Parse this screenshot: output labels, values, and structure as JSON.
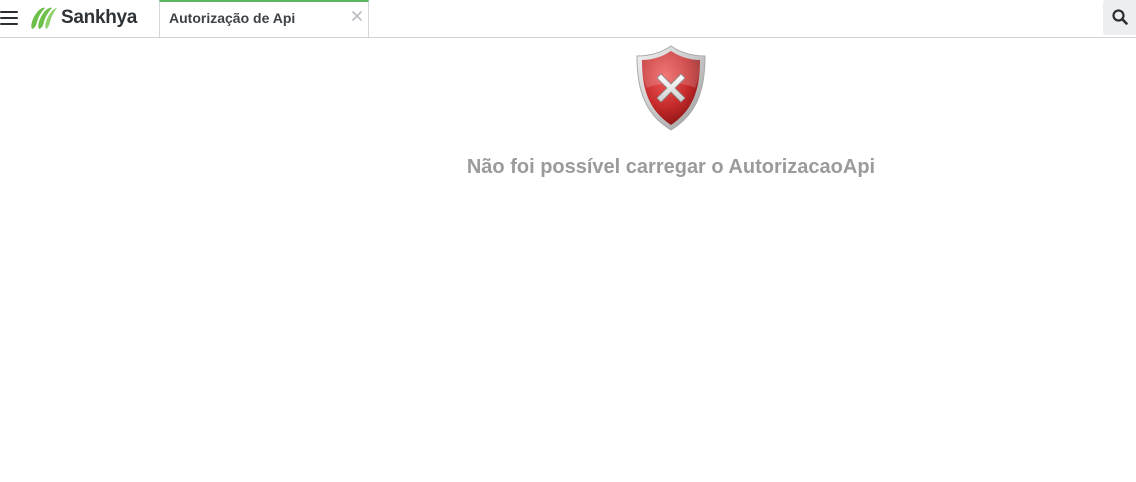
{
  "header": {
    "brand_name": "Sankhya",
    "brand_color": "#6cc04a",
    "menu_icon": "hamburger-icon",
    "search_icon": "search-icon"
  },
  "tabs": [
    {
      "label": "Autorização de Api",
      "active": true,
      "accent_color": "#5cb85c"
    }
  ],
  "main": {
    "error_icon": "error-shield-icon",
    "error_color": "#c62a2a",
    "message": "Não foi possível carregar o AutorizacaoApi",
    "message_color": "#9b9b9b"
  }
}
